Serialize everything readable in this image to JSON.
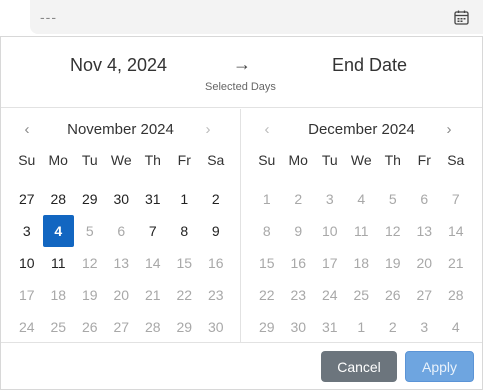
{
  "input": {
    "value": "---",
    "icon": "calendar-icon"
  },
  "range": {
    "start": "Nov 4, 2024",
    "arrow": "→",
    "end": "End Date",
    "subtitle": "Selected Days"
  },
  "weekdays": [
    "Su",
    "Mo",
    "Tu",
    "We",
    "Th",
    "Fr",
    "Sa"
  ],
  "left_month": {
    "title": "November 2024",
    "prev": "‹",
    "next": "›",
    "weeks": [
      [
        {
          "d": "27",
          "s": "in"
        },
        {
          "d": "28",
          "s": "in"
        },
        {
          "d": "29",
          "s": "in"
        },
        {
          "d": "30",
          "s": "in"
        },
        {
          "d": "31",
          "s": "in"
        },
        {
          "d": "1",
          "s": "in"
        },
        {
          "d": "2",
          "s": "in"
        }
      ],
      [
        {
          "d": "3",
          "s": "in"
        },
        {
          "d": "4",
          "s": "selected"
        },
        {
          "d": "5",
          "s": "out"
        },
        {
          "d": "6",
          "s": "out"
        },
        {
          "d": "7",
          "s": "in"
        },
        {
          "d": "8",
          "s": "in"
        },
        {
          "d": "9",
          "s": "in"
        }
      ],
      [
        {
          "d": "10",
          "s": "in"
        },
        {
          "d": "11",
          "s": "in"
        },
        {
          "d": "12",
          "s": "out"
        },
        {
          "d": "13",
          "s": "out"
        },
        {
          "d": "14",
          "s": "out"
        },
        {
          "d": "15",
          "s": "out"
        },
        {
          "d": "16",
          "s": "out"
        }
      ],
      [
        {
          "d": "17",
          "s": "out"
        },
        {
          "d": "18",
          "s": "out"
        },
        {
          "d": "19",
          "s": "out"
        },
        {
          "d": "20",
          "s": "out"
        },
        {
          "d": "21",
          "s": "out"
        },
        {
          "d": "22",
          "s": "out"
        },
        {
          "d": "23",
          "s": "out"
        }
      ],
      [
        {
          "d": "24",
          "s": "out"
        },
        {
          "d": "25",
          "s": "out"
        },
        {
          "d": "26",
          "s": "out"
        },
        {
          "d": "27",
          "s": "out"
        },
        {
          "d": "28",
          "s": "out"
        },
        {
          "d": "29",
          "s": "out"
        },
        {
          "d": "30",
          "s": "out"
        }
      ]
    ]
  },
  "right_month": {
    "title": "December 2024",
    "prev": "‹",
    "next": "›",
    "weeks": [
      [
        {
          "d": "1",
          "s": "out"
        },
        {
          "d": "2",
          "s": "out"
        },
        {
          "d": "3",
          "s": "out"
        },
        {
          "d": "4",
          "s": "out"
        },
        {
          "d": "5",
          "s": "out"
        },
        {
          "d": "6",
          "s": "out"
        },
        {
          "d": "7",
          "s": "out"
        }
      ],
      [
        {
          "d": "8",
          "s": "out"
        },
        {
          "d": "9",
          "s": "out"
        },
        {
          "d": "10",
          "s": "out"
        },
        {
          "d": "11",
          "s": "out"
        },
        {
          "d": "12",
          "s": "out"
        },
        {
          "d": "13",
          "s": "out"
        },
        {
          "d": "14",
          "s": "out"
        }
      ],
      [
        {
          "d": "15",
          "s": "out"
        },
        {
          "d": "16",
          "s": "out"
        },
        {
          "d": "17",
          "s": "out"
        },
        {
          "d": "18",
          "s": "out"
        },
        {
          "d": "19",
          "s": "out"
        },
        {
          "d": "20",
          "s": "out"
        },
        {
          "d": "21",
          "s": "out"
        }
      ],
      [
        {
          "d": "22",
          "s": "out"
        },
        {
          "d": "23",
          "s": "out"
        },
        {
          "d": "24",
          "s": "out"
        },
        {
          "d": "25",
          "s": "out"
        },
        {
          "d": "26",
          "s": "out"
        },
        {
          "d": "27",
          "s": "out"
        },
        {
          "d": "28",
          "s": "out"
        }
      ],
      [
        {
          "d": "29",
          "s": "out"
        },
        {
          "d": "30",
          "s": "out"
        },
        {
          "d": "31",
          "s": "out"
        },
        {
          "d": "1",
          "s": "out"
        },
        {
          "d": "2",
          "s": "out"
        },
        {
          "d": "3",
          "s": "out"
        },
        {
          "d": "4",
          "s": "out"
        }
      ]
    ]
  },
  "footer": {
    "cancel_label": "Cancel",
    "apply_label": "Apply"
  },
  "colors": {
    "selected": "#1266c1",
    "cancel": "#6c757d",
    "apply": "#6ea5e0"
  }
}
